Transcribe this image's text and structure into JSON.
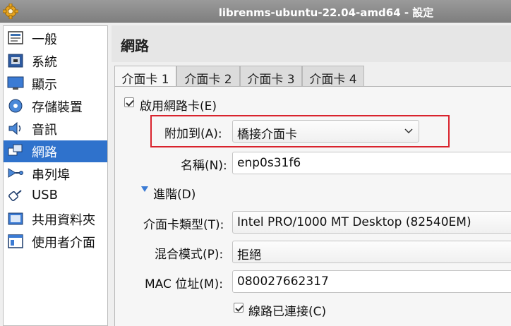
{
  "window": {
    "title": "librenms-ubuntu-22.04-amd64 - 設定"
  },
  "sidebar": {
    "items": [
      {
        "label": "一般",
        "icon": "general-icon"
      },
      {
        "label": "系統",
        "icon": "system-icon"
      },
      {
        "label": "顯示",
        "icon": "display-icon"
      },
      {
        "label": "存儲裝置",
        "icon": "storage-icon"
      },
      {
        "label": "音訊",
        "icon": "audio-icon"
      },
      {
        "label": "網路",
        "icon": "network-icon",
        "selected": true
      },
      {
        "label": "串列埠",
        "icon": "serial-port-icon"
      },
      {
        "label": "USB",
        "icon": "usb-icon"
      },
      {
        "label": "共用資料夾",
        "icon": "shared-folder-icon"
      },
      {
        "label": "使用者介面",
        "icon": "user-interface-icon"
      }
    ]
  },
  "page": {
    "title": "網路"
  },
  "tabs": [
    {
      "label": "介面卡 1",
      "active": true
    },
    {
      "label": "介面卡 2"
    },
    {
      "label": "介面卡 3"
    },
    {
      "label": "介面卡 4"
    }
  ],
  "adapter": {
    "enable_label": "啟用網路卡(E)",
    "enable_checked": true,
    "attached_label": "附加到(A):",
    "attached_value": "橋接介面卡",
    "name_label": "名稱(N):",
    "name_value": "enp0s31f6",
    "advanced_label": "進階(D)",
    "type_label": "介面卡類型(T):",
    "type_value": "Intel PRO/1000 MT Desktop (82540EM)",
    "promisc_label": "混合模式(P):",
    "promisc_value": "拒絕",
    "mac_label": "MAC 位址(M):",
    "mac_value": "080027662317",
    "cable_label": "線路已連接(C)",
    "cable_checked": true
  },
  "colors": {
    "selection": "#2f72cc",
    "highlight_box": "#d9232d"
  }
}
